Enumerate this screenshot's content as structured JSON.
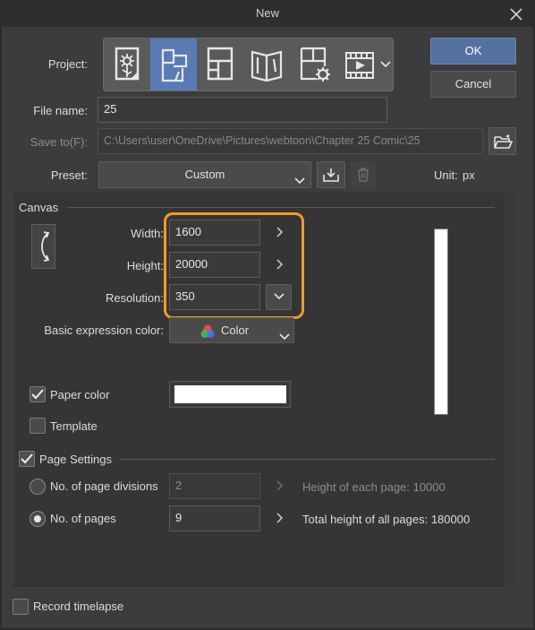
{
  "window": {
    "title": "New"
  },
  "project": {
    "label": "Project:",
    "icons": [
      "illustration-icon",
      "webtoon-icon",
      "comic-icon",
      "book-icon",
      "settings-document-icon",
      "animation-icon"
    ],
    "selected_index": 1
  },
  "buttons": {
    "ok": "OK",
    "cancel": "Cancel"
  },
  "file_name": {
    "label": "File name:",
    "value": "25"
  },
  "save_to": {
    "label": "Save to(F):",
    "value": "C:\\Users\\user\\OneDrive\\Pictures\\webtoon\\Chapter 25 Comic\\25"
  },
  "preset": {
    "label": "Preset:",
    "value": "Custom"
  },
  "unit": {
    "label": "Unit:",
    "value": "px"
  },
  "canvas": {
    "header": "Canvas",
    "width": {
      "label": "Width:",
      "value": "1600"
    },
    "height": {
      "label": "Height:",
      "value": "20000"
    },
    "resolution": {
      "label": "Resolution:",
      "value": "350"
    },
    "basic_expression_color": {
      "label": "Basic expression color:",
      "value": "Color"
    },
    "paper_color": {
      "label": "Paper color",
      "checked": true,
      "color": "#ffffff"
    },
    "template": {
      "label": "Template",
      "checked": false
    }
  },
  "page_settings": {
    "label": "Page Settings",
    "checked": true,
    "divisions": {
      "label": "No. of page divisions",
      "value": "2",
      "note": "Height of each page: 10000"
    },
    "pages": {
      "label": "No. of pages",
      "value": "9",
      "note": "Total height of all pages: 180000"
    }
  },
  "record_timelapse": {
    "label": "Record timelapse",
    "checked": false
  },
  "colors": {
    "accent": "#5a7ab3",
    "highlight": "#f09a2e",
    "background": "#3c3c3c"
  }
}
